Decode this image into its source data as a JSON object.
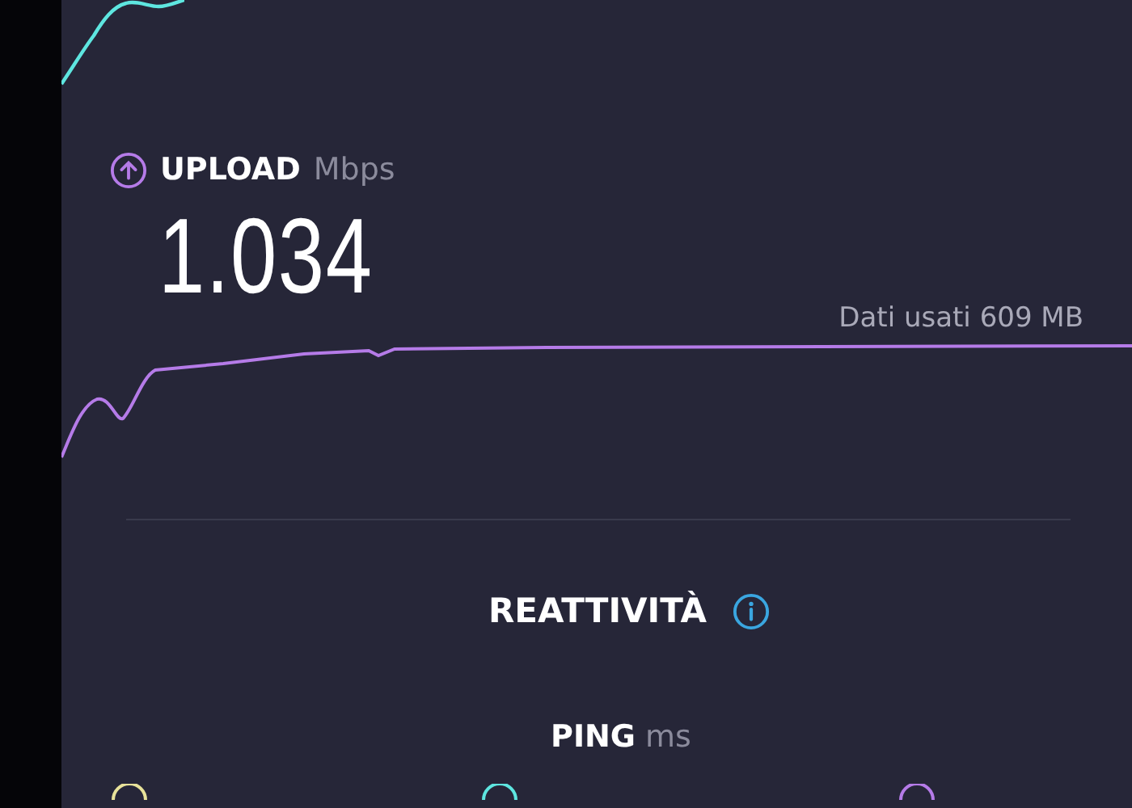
{
  "upload": {
    "label": "UPLOAD",
    "unit": "Mbps",
    "value": "1.034",
    "data_used": "Dati usati 609 MB"
  },
  "responsiveness": {
    "title": "REATTIVITÀ"
  },
  "ping": {
    "label": "PING",
    "unit": "ms"
  }
}
